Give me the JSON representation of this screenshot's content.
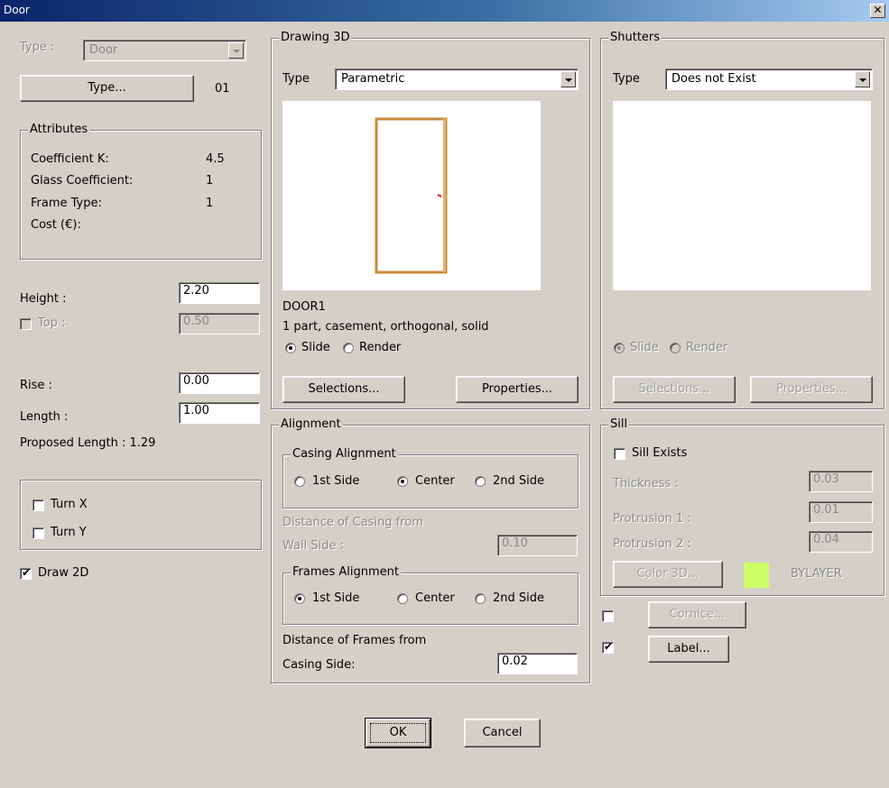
{
  "window": {
    "title": "Door",
    "close_glyph": "✕"
  },
  "left": {
    "type_label": "Type :",
    "type_value": "Door",
    "type_button": "Type...",
    "type_code": "01",
    "attributes": {
      "legend": "Attributes",
      "rows": [
        {
          "label": "Coefficient K:",
          "value": "4.5"
        },
        {
          "label": "Glass Coefficient:",
          "value": "1"
        },
        {
          "label": "Frame Type:",
          "value": "1"
        },
        {
          "label": "Cost (€):",
          "value": ""
        }
      ]
    },
    "height_label": "Height :",
    "height_value": "2.20",
    "top_label": "Top :",
    "top_value": "0.50",
    "rise_label": "Rise :",
    "rise_value": "0.00",
    "length_label": "Length :",
    "length_value": "1.00",
    "proposed_length": "Proposed Length : 1.29",
    "turn_x": "Turn X",
    "turn_y": "Turn Y",
    "draw_2d": "Draw 2D"
  },
  "drawing3d": {
    "legend": "Drawing 3D",
    "type_label": "Type",
    "type_value": "Parametric",
    "name": "DOOR1",
    "description": "1 part, casement, orthogonal, solid",
    "slide": "Slide",
    "render": "Render",
    "selections_button": "Selections...",
    "properties_button": "Properties...",
    "frame_color": "#c8893a"
  },
  "shutters": {
    "legend": "Shutters",
    "type_label": "Type",
    "type_value": "Does not Exist",
    "slide": "Slide",
    "render": "Render",
    "selections_button": "Selections...",
    "properties_button": "Properties..."
  },
  "alignment": {
    "legend": "Alignment",
    "casing_legend": "Casing Alignment",
    "casing_options": [
      "1st Side",
      "Center",
      "2nd Side"
    ],
    "casing_selected": "Center",
    "distance_casing_line1": "Distance of Casing from",
    "distance_casing_line2": "Wall Side :",
    "distance_casing_value": "0.10",
    "frames_legend": "Frames Alignment",
    "frames_options": [
      "1st Side",
      "Center",
      "2nd Side"
    ],
    "frames_selected": "1st Side",
    "distance_frames_line1": "Distance of Frames from",
    "distance_frames_line2": "Casing Side:",
    "distance_frames_value": "0.02"
  },
  "sill": {
    "legend": "Sill",
    "sill_exists": "Sill Exists",
    "thickness_label": "Thickness :",
    "thickness_value": "0.03",
    "protrusion1_label": "Protrusion 1 :",
    "protrusion1_value": "0.01",
    "protrusion2_label": "Protrusion 2 :",
    "protrusion2_value": "0.04",
    "color3d_button": "Color 3D...",
    "color_swatch": "#ccff66",
    "color_name": "BYLAYER"
  },
  "extras": {
    "cornice_button": "Cornice...",
    "label_button": "Label..."
  },
  "footer": {
    "ok": "OK",
    "cancel": "Cancel"
  }
}
